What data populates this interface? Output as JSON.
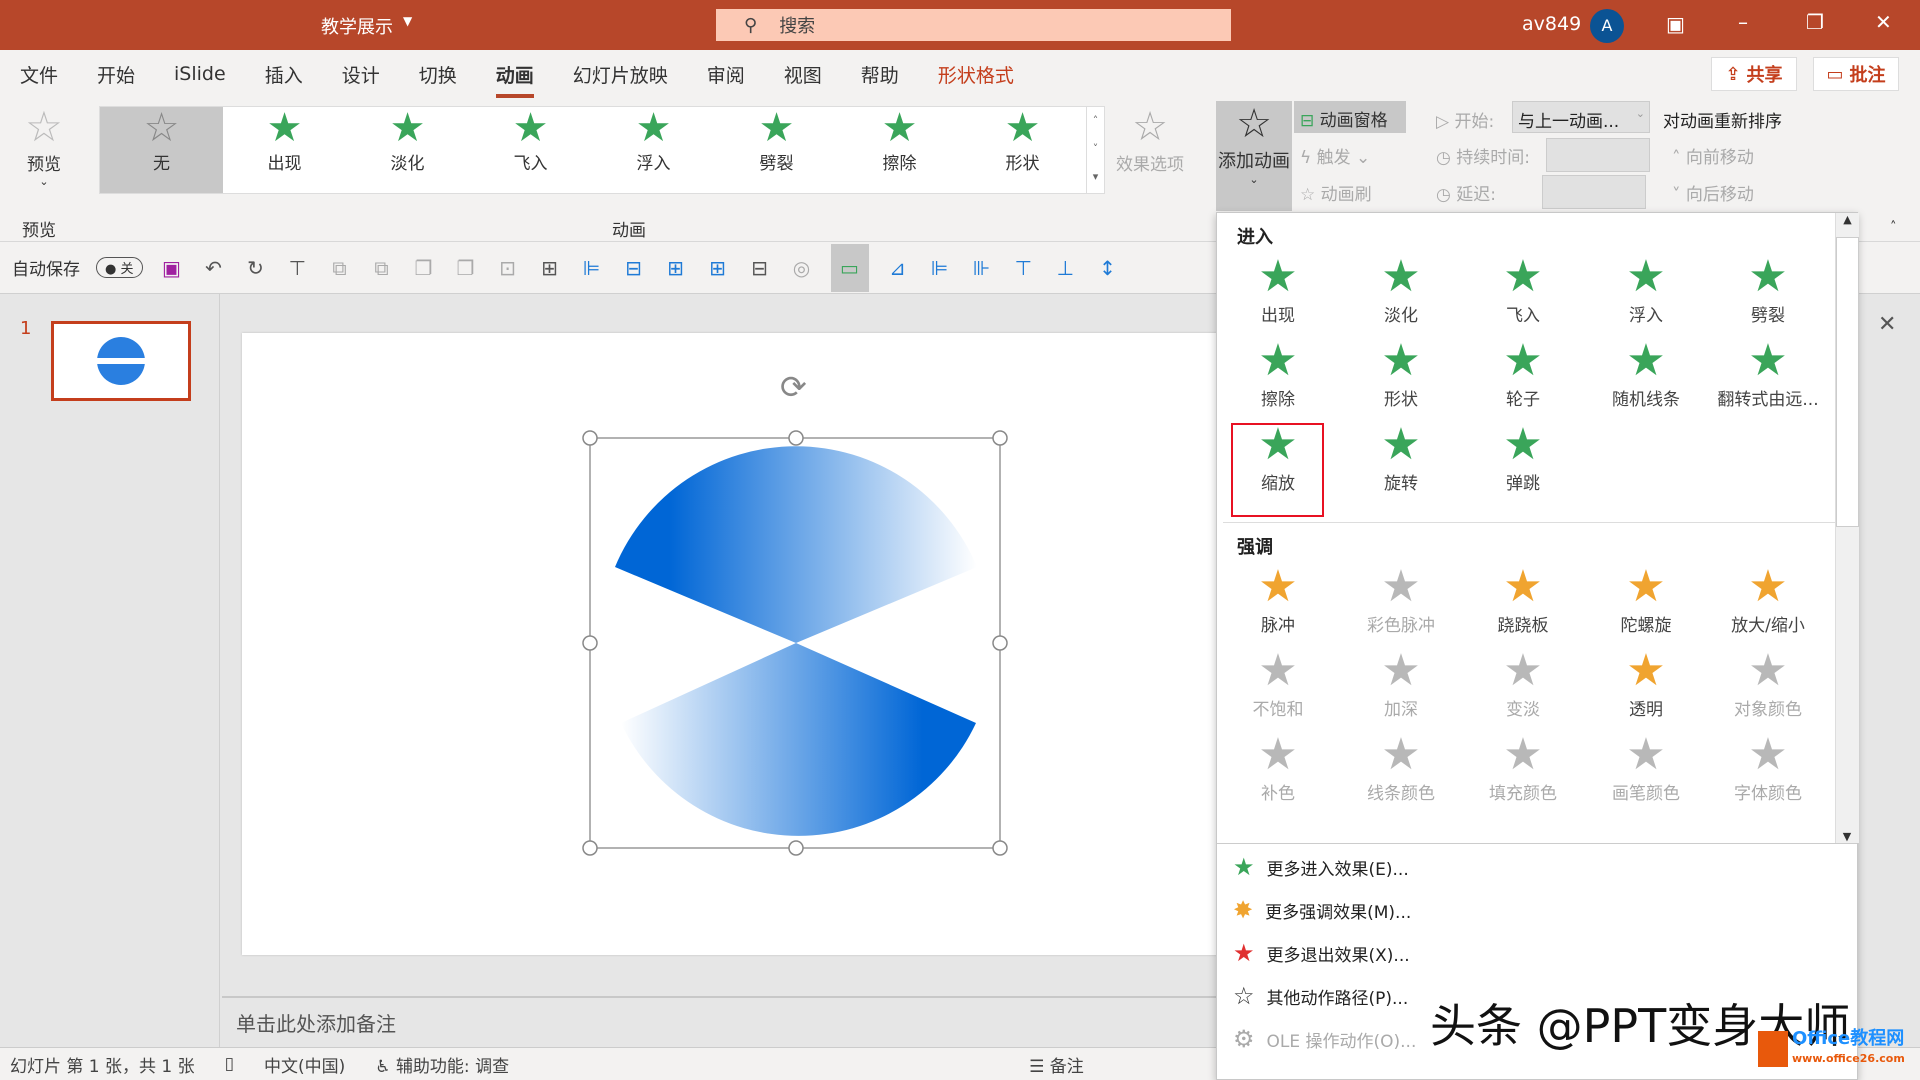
{
  "titlebar": {
    "doc_title": "教学展示",
    "search_placeholder": "搜索",
    "user": "av849",
    "avatar": "A"
  },
  "menu": {
    "tabs": [
      "文件",
      "开始",
      "iSlide",
      "插入",
      "设计",
      "切换",
      "动画",
      "幻灯片放映",
      "审阅",
      "视图",
      "帮助",
      "形状格式"
    ],
    "active": "动画",
    "share": "共享",
    "comment": "批注"
  },
  "ribbon": {
    "preview": "预览",
    "preview_group": "预览",
    "gallery": [
      "无",
      "出现",
      "淡化",
      "飞入",
      "浮入",
      "劈裂",
      "擦除",
      "形状"
    ],
    "gallery_group": "动画",
    "effect_options": "效果选项",
    "add_animation": "添加动画",
    "animation_pane": "动画窗格",
    "trigger": "触发",
    "painter": "动画刷",
    "start_label": "开始:",
    "start_value": "与上一动画...",
    "duration_label": "持续时间:",
    "delay_label": "延迟:",
    "reorder": "对动画重新排序",
    "move_earlier": "向前移动",
    "move_later": "向后移动"
  },
  "qat": {
    "autosave": "自动保存",
    "toggle": "关"
  },
  "thumbs": {
    "number": "1"
  },
  "notes": {
    "placeholder": "单击此处添加备注"
  },
  "status": {
    "slide": "幻灯片 第 1 张，共 1 张",
    "lang": "中文(中国)",
    "access": "辅助功能: 调查",
    "notes_btn": "备注"
  },
  "panel": {
    "enter_title": "进入",
    "enter": [
      "出现",
      "淡化",
      "飞入",
      "浮入",
      "劈裂",
      "擦除",
      "形状",
      "轮子",
      "随机线条",
      "翻转式由远...",
      "缩放",
      "旋转",
      "弹跳"
    ],
    "selected": "缩放",
    "emph_title": "强调",
    "emph": [
      "脉冲",
      "彩色脉冲",
      "跷跷板",
      "陀螺旋",
      "放大/缩小",
      "不饱和",
      "加深",
      "变淡",
      "透明",
      "对象颜色",
      "补色",
      "线条颜色",
      "填充颜色",
      "画笔颜色",
      "字体颜色"
    ],
    "more": [
      "更多进入效果(E)...",
      "更多强调效果(M)...",
      "更多退出效果(X)...",
      "其他动作路径(P)...",
      "OLE 操作动作(O)..."
    ]
  },
  "watermark": {
    "text": "头条 @PPT变身大师",
    "logo": "Office教程网",
    "url": "www.office26.com"
  },
  "colors": {
    "brand": "#b7472a",
    "enter": "#3aa55a",
    "emphasis": "#f0a430",
    "shape_blue": "#0066d6",
    "highlight": "#e81123"
  }
}
